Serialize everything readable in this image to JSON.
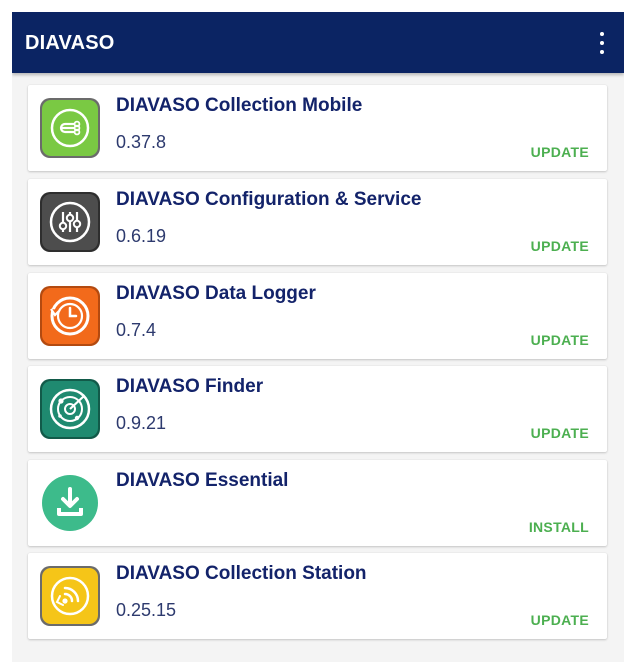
{
  "appbar": {
    "title": "DIAVASO",
    "menu_icon": "overflow-menu-icon"
  },
  "colors": {
    "appbar": "#0b2463",
    "title_text": "#13236a",
    "action_text": "#4caf50",
    "background": "#f4f4f4"
  },
  "apps": [
    {
      "name": "DIAVASO Collection Mobile",
      "version": "0.37.8",
      "action": "UPDATE",
      "icon": "collection-mobile-icon",
      "icon_color": "#7ac943"
    },
    {
      "name": "DIAVASO Configuration & Service",
      "version": "0.6.19",
      "action": "UPDATE",
      "icon": "configuration-sliders-icon",
      "icon_color": "#4d4d4d"
    },
    {
      "name": "DIAVASO Data Logger",
      "version": "0.7.4",
      "action": "UPDATE",
      "icon": "data-logger-clock-icon",
      "icon_color": "#f26a1b"
    },
    {
      "name": "DIAVASO Finder",
      "version": "0.9.21",
      "action": "UPDATE",
      "icon": "finder-radar-icon",
      "icon_color": "#1f8a70"
    },
    {
      "name": "DIAVASO Essential",
      "version": "",
      "action": "INSTALL",
      "icon": "download-icon",
      "icon_color": "#3dbb8b"
    },
    {
      "name": "DIAVASO Collection Station",
      "version": "0.25.15",
      "action": "UPDATE",
      "icon": "collection-station-signal-icon",
      "icon_color": "#f5c518"
    }
  ]
}
